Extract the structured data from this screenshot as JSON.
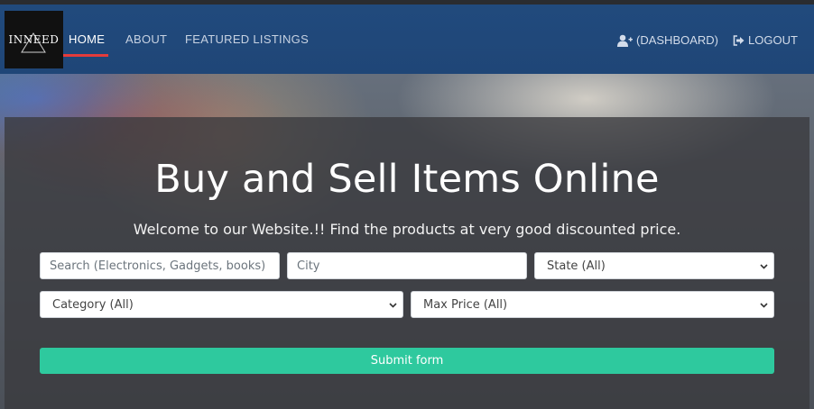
{
  "nav": {
    "logo_text": "INNEED",
    "links": [
      "HOME",
      "ABOUT",
      "FEATURED LISTINGS"
    ],
    "dashboard_label": "(DASHBOARD)",
    "logout_label": "LOGOUT",
    "active_color": "#e53b3b",
    "background": "#214a7d"
  },
  "hero": {
    "title": "Buy and Sell Items Online",
    "subtitle": "Welcome to our Website.!! Find the products at very good discounted price."
  },
  "form": {
    "search_placeholder": "Search (Electronics, Gadgets, books)",
    "city_placeholder": "City",
    "state_value": "State (All)",
    "category_value": "Category (All)",
    "max_price_value": "Max Price (All)",
    "submit_label": "Submit form",
    "submit_color": "#2ec99e"
  },
  "icons": {
    "dashboard": "user-plus-icon",
    "logout": "sign-out-icon",
    "select": "chevron-down-icon"
  }
}
